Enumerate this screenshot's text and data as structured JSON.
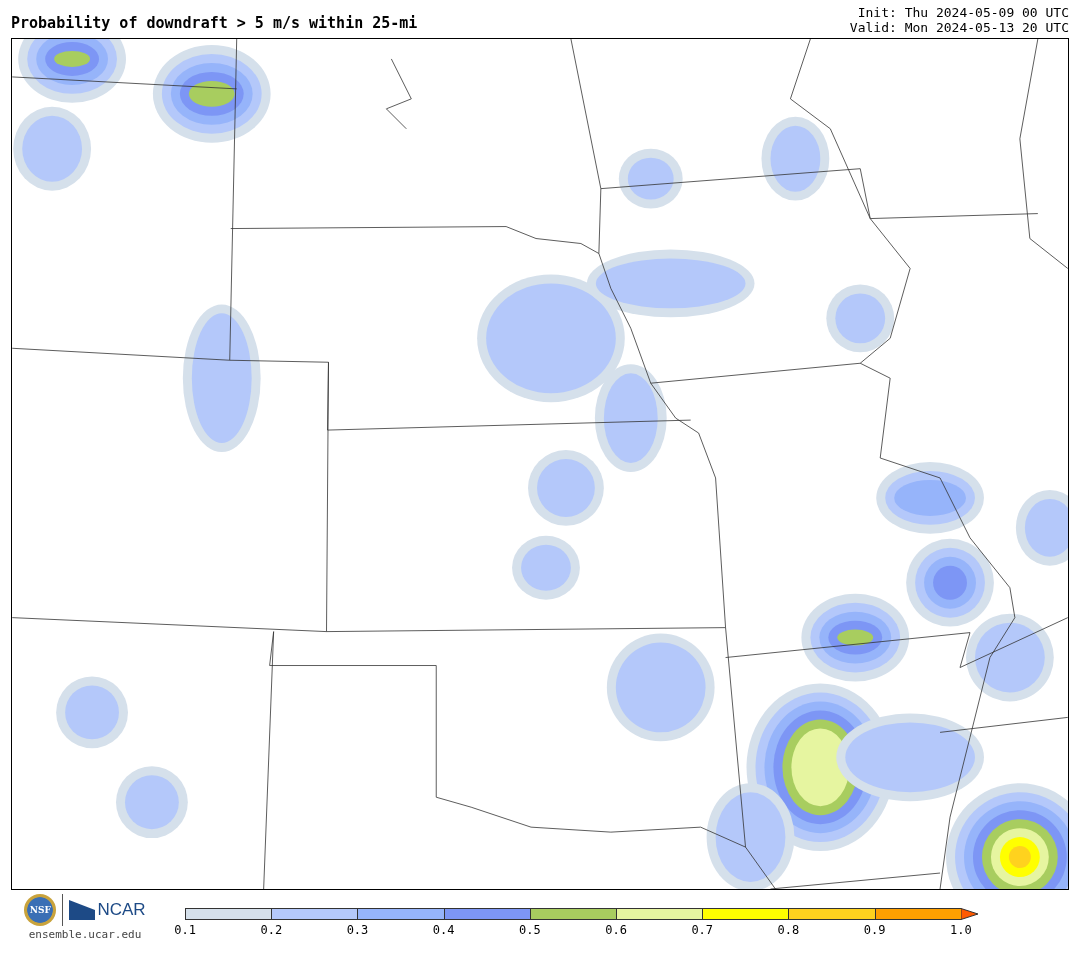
{
  "title": "Probability of downdraft > 5 m/s within 25-mi",
  "init": "Init: Thu 2024-05-09 00 UTC",
  "valid": "Valid: Mon 2024-05-13 20 UTC",
  "logos": {
    "nsf": "NSF",
    "ncar": "NCAR",
    "site": "ensemble.ucar.edu"
  },
  "colorbar": {
    "segments": [
      {
        "color": "#d5e0eb"
      },
      {
        "color": "#b4c8fa"
      },
      {
        "color": "#96b4fa"
      },
      {
        "color": "#7d96f5"
      },
      {
        "color": "#a8cd5f"
      },
      {
        "color": "#e6f5a0"
      },
      {
        "color": "#ffff00"
      },
      {
        "color": "#ffd21e"
      },
      {
        "color": "#ffa000"
      },
      {
        "color": "#ff5a00"
      }
    ],
    "ticks": [
      "0.1",
      "0.2",
      "0.3",
      "0.4",
      "0.5",
      "0.6",
      "0.7",
      "0.8",
      "0.9",
      "1.0"
    ]
  }
}
